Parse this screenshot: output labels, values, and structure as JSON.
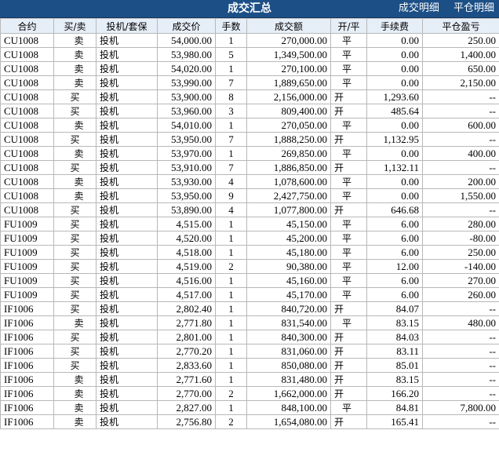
{
  "header": {
    "title": "成交汇总",
    "link_trade_detail": "成交明细",
    "link_close_detail": "平仓明细"
  },
  "columns": [
    "合约",
    "买/卖",
    "投机/套保",
    "成交价",
    "手数",
    "成交额",
    "开/平",
    "手续费",
    "平仓盈亏"
  ],
  "rows": [
    [
      "CU1008",
      "卖",
      "投机",
      "54,000.00",
      "1",
      "270,000.00",
      "平",
      "0.00",
      "250.00"
    ],
    [
      "CU1008",
      "卖",
      "投机",
      "53,980.00",
      "5",
      "1,349,500.00",
      "平",
      "0.00",
      "1,400.00"
    ],
    [
      "CU1008",
      "卖",
      "投机",
      "54,020.00",
      "1",
      "270,100.00",
      "平",
      "0.00",
      "650.00"
    ],
    [
      "CU1008",
      "卖",
      "投机",
      "53,990.00",
      "7",
      "1,889,650.00",
      "平",
      "0.00",
      "2,150.00"
    ],
    [
      "CU1008",
      "买",
      "投机",
      "53,900.00",
      "8",
      "2,156,000.00",
      "开",
      "1,293.60",
      "--"
    ],
    [
      "CU1008",
      "买",
      "投机",
      "53,960.00",
      "3",
      "809,400.00",
      "开",
      "485.64",
      "--"
    ],
    [
      "CU1008",
      "卖",
      "投机",
      "54,010.00",
      "1",
      "270,050.00",
      "平",
      "0.00",
      "600.00"
    ],
    [
      "CU1008",
      "买",
      "投机",
      "53,950.00",
      "7",
      "1,888,250.00",
      "开",
      "1,132.95",
      "--"
    ],
    [
      "CU1008",
      "卖",
      "投机",
      "53,970.00",
      "1",
      "269,850.00",
      "平",
      "0.00",
      "400.00"
    ],
    [
      "CU1008",
      "买",
      "投机",
      "53,910.00",
      "7",
      "1,886,850.00",
      "开",
      "1,132.11",
      "--"
    ],
    [
      "CU1008",
      "卖",
      "投机",
      "53,930.00",
      "4",
      "1,078,600.00",
      "平",
      "0.00",
      "200.00"
    ],
    [
      "CU1008",
      "卖",
      "投机",
      "53,950.00",
      "9",
      "2,427,750.00",
      "平",
      "0.00",
      "1,550.00"
    ],
    [
      "CU1008",
      "买",
      "投机",
      "53,890.00",
      "4",
      "1,077,800.00",
      "开",
      "646.68",
      "--"
    ],
    [
      "FU1009",
      "买",
      "投机",
      "4,515.00",
      "1",
      "45,150.00",
      "平",
      "6.00",
      "280.00"
    ],
    [
      "FU1009",
      "买",
      "投机",
      "4,520.00",
      "1",
      "45,200.00",
      "平",
      "6.00",
      "-80.00"
    ],
    [
      "FU1009",
      "买",
      "投机",
      "4,518.00",
      "1",
      "45,180.00",
      "平",
      "6.00",
      "250.00"
    ],
    [
      "FU1009",
      "买",
      "投机",
      "4,519.00",
      "2",
      "90,380.00",
      "平",
      "12.00",
      "-140.00"
    ],
    [
      "FU1009",
      "买",
      "投机",
      "4,516.00",
      "1",
      "45,160.00",
      "平",
      "6.00",
      "270.00"
    ],
    [
      "FU1009",
      "买",
      "投机",
      "4,517.00",
      "1",
      "45,170.00",
      "平",
      "6.00",
      "260.00"
    ],
    [
      "IF1006",
      "买",
      "投机",
      "2,802.40",
      "1",
      "840,720.00",
      "开",
      "84.07",
      "--"
    ],
    [
      "IF1006",
      "卖",
      "投机",
      "2,771.80",
      "1",
      "831,540.00",
      "平",
      "83.15",
      "480.00"
    ],
    [
      "IF1006",
      "买",
      "投机",
      "2,801.00",
      "1",
      "840,300.00",
      "开",
      "84.03",
      "--"
    ],
    [
      "IF1006",
      "买",
      "投机",
      "2,770.20",
      "1",
      "831,060.00",
      "开",
      "83.11",
      "--"
    ],
    [
      "IF1006",
      "买",
      "投机",
      "2,833.60",
      "1",
      "850,080.00",
      "开",
      "85.01",
      "--"
    ],
    [
      "IF1006",
      "卖",
      "投机",
      "2,771.60",
      "1",
      "831,480.00",
      "开",
      "83.15",
      "--"
    ],
    [
      "IF1006",
      "卖",
      "投机",
      "2,770.00",
      "2",
      "1,662,000.00",
      "开",
      "166.20",
      "--"
    ],
    [
      "IF1006",
      "卖",
      "投机",
      "2,827.00",
      "1",
      "848,100.00",
      "平",
      "84.81",
      "7,800.00"
    ],
    [
      "IF1006",
      "卖",
      "投机",
      "2,756.80",
      "2",
      "1,654,080.00",
      "开",
      "165.41",
      "--"
    ]
  ]
}
